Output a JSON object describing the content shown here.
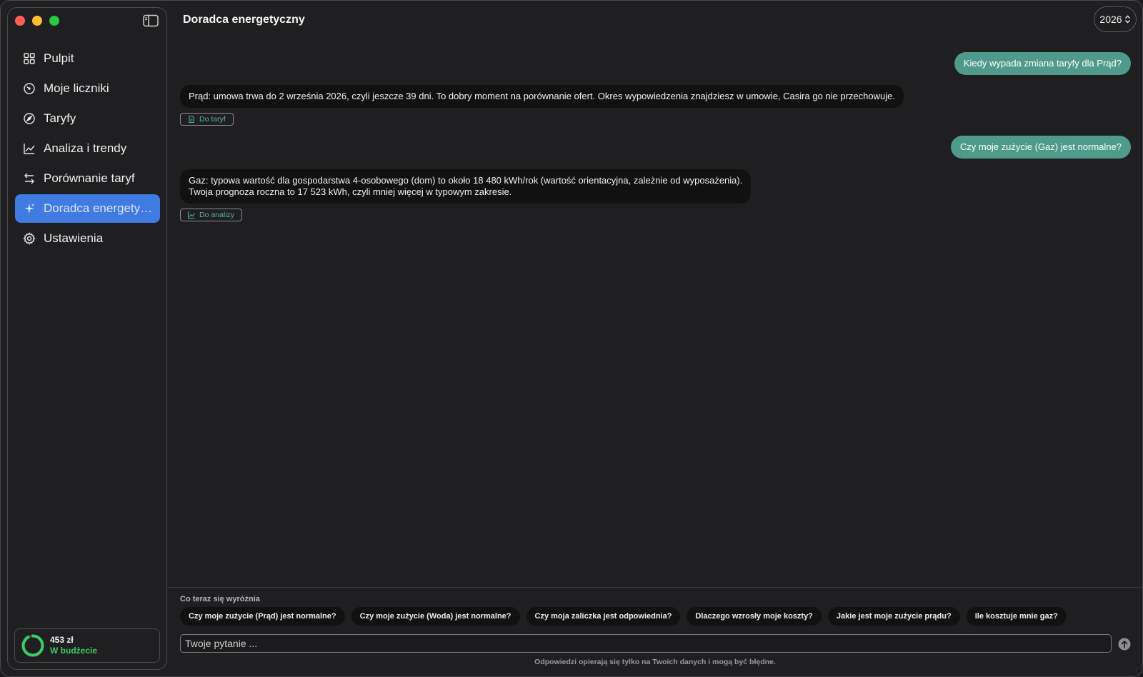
{
  "sidebar": {
    "items": [
      {
        "label": "Pulpit",
        "icon": "grid-icon"
      },
      {
        "label": "Moje liczniki",
        "icon": "gauge-icon"
      },
      {
        "label": "Taryfy",
        "icon": "compass-icon"
      },
      {
        "label": "Analiza i trendy",
        "icon": "line-chart-icon"
      },
      {
        "label": "Porównanie taryf",
        "icon": "arrows-swap-icon"
      },
      {
        "label": "Doradca energetyczny",
        "icon": "sparkles-icon",
        "active": true
      },
      {
        "label": "Ustawienia",
        "icon": "gear-icon"
      }
    ],
    "budget": {
      "amount": "453 zł",
      "status": "W budżecie",
      "progress": 0.92,
      "color": "#3ecb6a"
    }
  },
  "header": {
    "title": "Doradca energetyczny",
    "year": "2026"
  },
  "chat": {
    "messages": [
      {
        "role": "user",
        "text": "Kiedy wypada zmiana taryfy dla Prąd?"
      },
      {
        "role": "assistant",
        "lines": [
          "Prąd: umowa trwa do 2 września 2026, czyli jeszcze 39 dni. To dobry moment na porównanie ofert. Okres wypowiedzenia znajdziesz w umowie, Casira go nie przechowuje."
        ],
        "action": "Do taryf"
      },
      {
        "role": "user",
        "text": "Czy moje zużycie (Gaz) jest normalne?"
      },
      {
        "role": "assistant",
        "lines": [
          "Gaz: typowa wartość dla gospodarstwa 4-osobowego (dom) to około 18 480 kWh/rok (wartość orientacyjna, zależnie od wyposażenia).",
          "Twoja prognoza roczna to 17 523 kWh, czyli mniej więcej w typowym zakresie."
        ],
        "action": "Do analizy"
      }
    ]
  },
  "suggestions": {
    "title": "Co teraz się wyróżnia",
    "chips": [
      "Czy moje zużycie (Prąd) jest normalne?",
      "Czy moje zużycie (Woda) jest normalne?",
      "Czy moja zaliczka jest odpowiednia?",
      "Dlaczego wzrosły moje koszty?",
      "Jakie jest moje zużycie prądu?",
      "Ile kosztuje mnie gaz?"
    ]
  },
  "input": {
    "placeholder": "Twoje pytanie ..."
  },
  "disclaimer": "Odpowiedzi opierają się tylko na Twoich danych i mogą być błędne.",
  "colors": {
    "accent": "#3f7be0",
    "user_bubble": "#4f9b8b",
    "link": "#57b3a0"
  }
}
